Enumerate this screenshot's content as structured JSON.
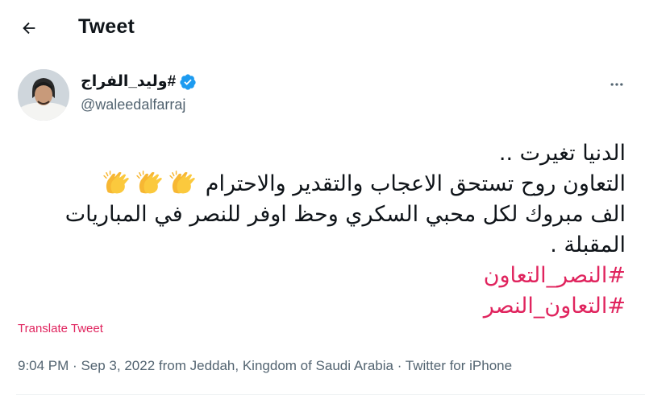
{
  "header": {
    "title": "Tweet",
    "back_icon": "arrow-left-icon"
  },
  "author": {
    "display_name": "#وليد_الفراج",
    "handle": "@waleedalfarraj",
    "verified_icon": "verified-badge-icon",
    "verified_color": "#1d9bf0"
  },
  "more_icon": "more-horizontal-icon",
  "tweet": {
    "line1": "الدنيا تغيرت ..",
    "line2": "التعاون روح تستحق الاعجاب والتقدير والاحترام",
    "line2_emoji": "clapping-hands-icon",
    "line3": "الف مبروك لكل محبي السكري وحظ اوفر للنصر في المباريات",
    "line4": "المقبلة .",
    "hashtag1": "#النصر_التعاون",
    "hashtag2": "#التعاون_النصر",
    "hashtag_color": "#e0245e"
  },
  "translate_label": "Translate Tweet",
  "meta": {
    "time": "9:04 PM",
    "separator": "·",
    "date": "Sep 3, 2022",
    "location": "from Jeddah, Kingdom of Saudi Arabia",
    "source": "Twitter for iPhone"
  }
}
